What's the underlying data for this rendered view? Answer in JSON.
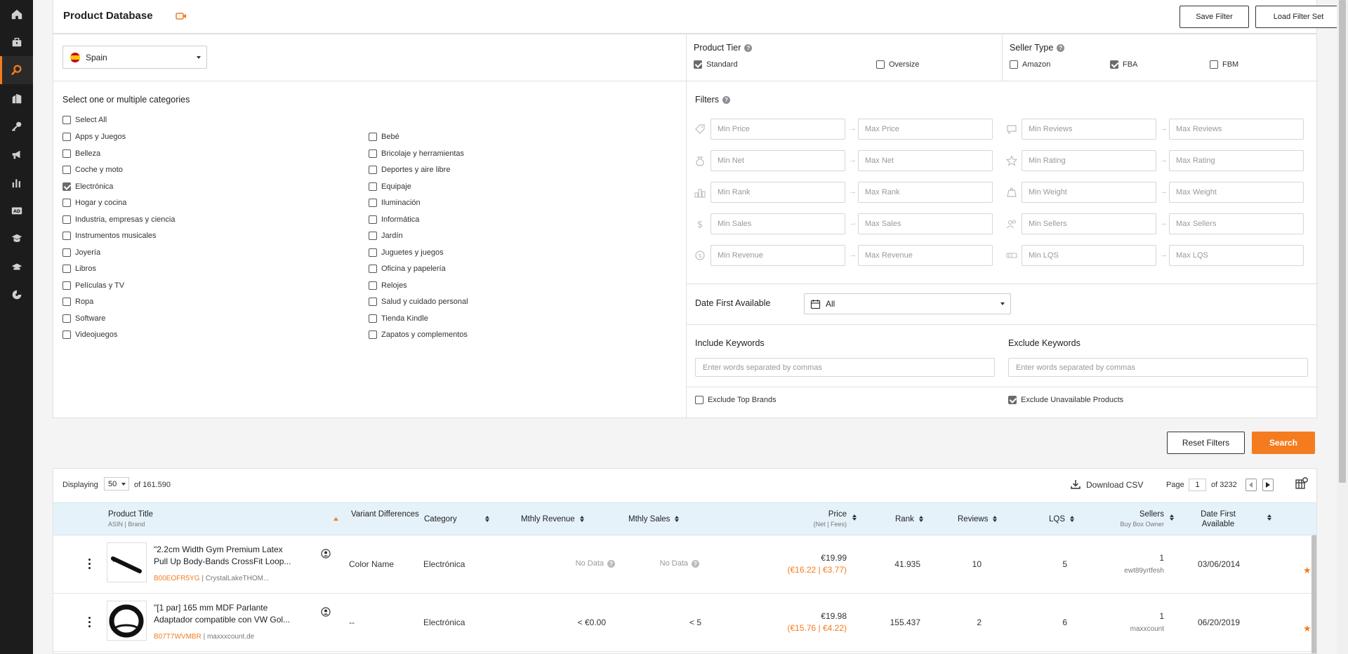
{
  "sidebar": {
    "items": [
      {
        "icon": "home-icon"
      },
      {
        "icon": "briefcase-icon"
      },
      {
        "icon": "search-icon",
        "active": true
      },
      {
        "icon": "buildings-icon"
      },
      {
        "icon": "key-icon"
      },
      {
        "icon": "megaphone-icon"
      },
      {
        "icon": "bar-chart-icon"
      },
      {
        "icon": "ad-icon"
      },
      {
        "icon": "academy-icon"
      },
      {
        "icon": "graduation-cap-icon"
      },
      {
        "icon": "chart-pie-icon"
      }
    ]
  },
  "header": {
    "title": "Product Database",
    "save_filter": "Save Filter",
    "load_filter_set": "Load Filter Set"
  },
  "marketplace": {
    "selected": "Spain"
  },
  "categories": {
    "heading": "Select one or multiple categories",
    "select_all": "Select All",
    "left": [
      {
        "label": "Apps y Juegos",
        "checked": false
      },
      {
        "label": "Belleza",
        "checked": false
      },
      {
        "label": "Coche y moto",
        "checked": false
      },
      {
        "label": "Electrónica",
        "checked": true
      },
      {
        "label": "Hogar y cocina",
        "checked": false
      },
      {
        "label": "Industria, empresas y ciencia",
        "checked": false
      },
      {
        "label": "Instrumentos musicales",
        "checked": false
      },
      {
        "label": "Joyería",
        "checked": false
      },
      {
        "label": "Libros",
        "checked": false
      },
      {
        "label": "Películas y TV",
        "checked": false
      },
      {
        "label": "Ropa",
        "checked": false
      },
      {
        "label": "Software",
        "checked": false
      },
      {
        "label": "Videojuegos",
        "checked": false
      }
    ],
    "right": [
      {
        "label": "Bebé",
        "checked": false
      },
      {
        "label": "Bricolaje y herramientas",
        "checked": false
      },
      {
        "label": "Deportes y aire libre",
        "checked": false
      },
      {
        "label": "Equipaje",
        "checked": false
      },
      {
        "label": "Iluminación",
        "checked": false
      },
      {
        "label": "Informática",
        "checked": false
      },
      {
        "label": "Jardín",
        "checked": false
      },
      {
        "label": "Juguetes y juegos",
        "checked": false
      },
      {
        "label": "Oficina y papelería",
        "checked": false
      },
      {
        "label": "Relojes",
        "checked": false
      },
      {
        "label": "Salud y cuidado personal",
        "checked": false
      },
      {
        "label": "Tienda Kindle",
        "checked": false
      },
      {
        "label": "Zapatos y complementos",
        "checked": false
      }
    ]
  },
  "product_tier": {
    "label": "Product Tier",
    "options": [
      {
        "label": "Standard",
        "checked": true
      },
      {
        "label": "Oversize",
        "checked": false
      }
    ]
  },
  "seller_type": {
    "label": "Seller Type",
    "options": [
      {
        "label": "Amazon",
        "checked": false
      },
      {
        "label": "FBA",
        "checked": true
      },
      {
        "label": "FBM",
        "checked": false
      }
    ]
  },
  "filters": {
    "label": "Filters",
    "left": [
      {
        "icon": "price-tag-icon",
        "min": "Min Price",
        "max": "Max Price"
      },
      {
        "icon": "money-bag-icon",
        "min": "Min Net",
        "max": "Max Net"
      },
      {
        "icon": "podium-icon",
        "min": "Min Rank",
        "max": "Max Rank"
      },
      {
        "icon": "dollar-coin-icon",
        "min": "Min Sales",
        "max": "Max Sales"
      },
      {
        "icon": "revenue-coin-icon",
        "min": "Min Revenue",
        "max": "Max Revenue"
      }
    ],
    "right": [
      {
        "icon": "comment-icon",
        "min": "Min Reviews",
        "max": "Max Reviews"
      },
      {
        "icon": "star-outline-icon",
        "min": "Min Rating",
        "max": "Max Rating"
      },
      {
        "icon": "weight-icon",
        "min": "Min Weight",
        "max": "Max Weight"
      },
      {
        "icon": "users-icon",
        "min": "Min Sellers",
        "max": "Max Sellers"
      },
      {
        "icon": "lqs-icon",
        "min": "Min LQS",
        "max": "Max LQS"
      }
    ]
  },
  "date_first_available": {
    "label": "Date First Available",
    "selected": "All"
  },
  "keywords": {
    "include_label": "Include Keywords",
    "exclude_label": "Exclude Keywords",
    "placeholder": "Enter words separated by commas"
  },
  "exclude_top_brands": {
    "label": "Exclude Top Brands",
    "checked": false
  },
  "exclude_unavailable": {
    "label": "Exclude Unavailable Products",
    "checked": true
  },
  "actions": {
    "reset": "Reset Filters",
    "search": "Search"
  },
  "results": {
    "displaying_label": "Displaying",
    "per_page": "50",
    "of_total": "of 161.590",
    "download_csv": "Download CSV",
    "page_label": "Page",
    "page": "1",
    "of_pages": "of 3232",
    "columns": {
      "title": "Product Title",
      "title_sub": "ASIN | Brand",
      "variant": "Variant Differences",
      "category": "Category",
      "revenue": "Mthly Revenue",
      "sales": "Mthly Sales",
      "price": "Price",
      "price_sub": "(Net | Fees)",
      "rank": "Rank",
      "reviews": "Reviews",
      "lqs": "LQS",
      "sellers": "Sellers",
      "sellers_sub": "Buy Box Owner",
      "date": "Date First Available"
    },
    "rows": [
      {
        "title_line1": "\"2.2cm Width Gym Premium Latex",
        "title_line2": "Pull Up Body-Bands CrossFit Loop...",
        "asin": "B00EOFR5YG",
        "brand": "CrystalLakeTHOM...",
        "variant": "Color Name",
        "category": "Electrónica",
        "revenue": "No Data",
        "sales": "No Data",
        "price": "€19.99",
        "net": "€16.22",
        "fees": "€3.77",
        "rank": "41.935",
        "reviews": "10",
        "lqs": "5",
        "sellers": "1",
        "bb_owner": "ewt89yrtfesh",
        "date": "03/06/2014"
      },
      {
        "title_line1": "\"[1 par] 165 mm MDF Parlante",
        "title_line2": "Adaptador compatible con VW Gol...",
        "asin": "B07T7WVMBR",
        "brand": "maxxxcount.de",
        "variant": "--",
        "category": "Electrónica",
        "revenue": "< €0.00",
        "sales": "< 5",
        "price": "€19.98",
        "net": "€15.76",
        "fees": "€4.22",
        "rank": "155.437",
        "reviews": "2",
        "lqs": "6",
        "sellers": "1",
        "bb_owner": "maxxcount",
        "date": "06/20/2019"
      }
    ]
  },
  "colors": {
    "accent": "#f47c1f",
    "sidebar": "#1c1c1c",
    "header_row": "#e6f2fa"
  }
}
